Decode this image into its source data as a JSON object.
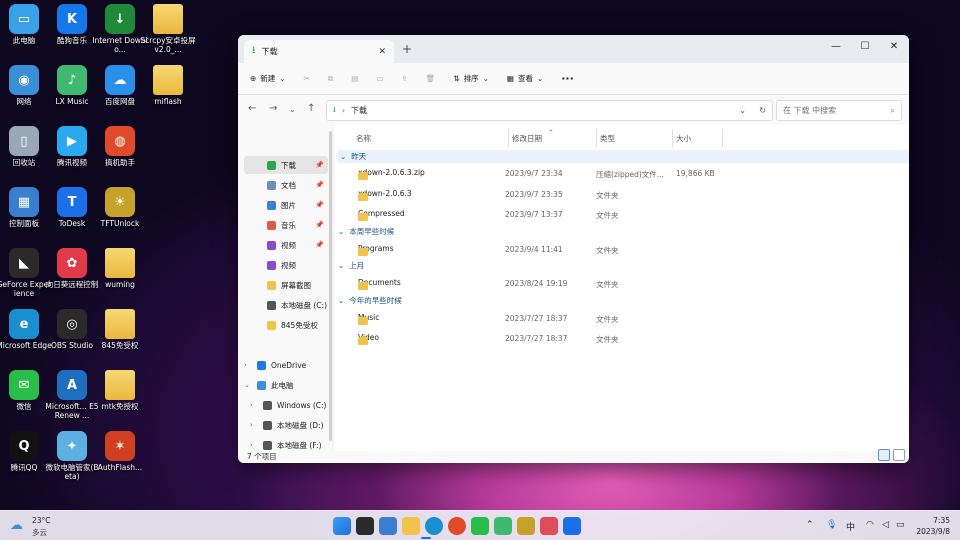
{
  "desktop": [
    {
      "label": "此电脑",
      "color": "#3aa0e8",
      "glyph": "▭"
    },
    {
      "label": "网络",
      "color": "#3a8fd8",
      "glyph": "◉"
    },
    {
      "label": "回收站",
      "color": "#9aa7b8",
      "glyph": "▯"
    },
    {
      "label": "控制面板",
      "color": "#3a7fcf",
      "glyph": "▦"
    },
    {
      "label": "GeForce Experience",
      "color": "#2a2a2a",
      "glyph": "◣"
    },
    {
      "label": "Microsoft Edge",
      "color": "#1a8fd0",
      "glyph": "e"
    },
    {
      "label": "微信",
      "color": "#2bbd4a",
      "glyph": "✉"
    },
    {
      "label": "腾讯QQ",
      "color": "#111111",
      "glyph": "Q"
    },
    {
      "label": "酷狗音乐",
      "color": "#1577e8",
      "glyph": "K"
    },
    {
      "label": "LX Music",
      "color": "#3fb96f",
      "glyph": "♪"
    },
    {
      "label": "腾讯视频",
      "color": "#2aa8f0",
      "glyph": "▶"
    },
    {
      "label": "ToDesk",
      "color": "#1b6fe8",
      "glyph": "T"
    },
    {
      "label": "向日葵远程控制",
      "color": "#e23a4a",
      "glyph": "✿"
    },
    {
      "label": "OBS Studio",
      "color": "#2a2a2a",
      "glyph": "◎"
    },
    {
      "label": "Microsoft... E5 Renew ...",
      "color": "#1f6fc0",
      "glyph": "A"
    },
    {
      "label": "微软电脑管家(Beta)",
      "color": "#5ab0e0",
      "glyph": "✦"
    },
    {
      "label": "Internet Downlo...",
      "color": "#1e8a3a",
      "glyph": "↓"
    },
    {
      "label": "百度网盘",
      "color": "#2a8fe8",
      "glyph": "☁"
    },
    {
      "label": "搞机助手",
      "color": "#e04a2a",
      "glyph": "◍"
    },
    {
      "label": "TFTUnlock",
      "color": "#c7a22a",
      "glyph": "☀"
    },
    {
      "label": "wuming",
      "color": "folder",
      "glyph": ""
    },
    {
      "label": "845免受权",
      "color": "folder",
      "glyph": ""
    },
    {
      "label": "mtk免授权",
      "color": "folder",
      "glyph": ""
    },
    {
      "label": "AuthFlash...",
      "color": "#d04020",
      "glyph": "✶"
    },
    {
      "label": "Scrcpy安卓投屏v2.0_...",
      "color": "folder",
      "glyph": ""
    },
    {
      "label": "miflash",
      "color": "folder",
      "glyph": ""
    }
  ],
  "window": {
    "tab_title": "下载",
    "new_tab": "+",
    "toolbar": {
      "new_label": "新建",
      "sort_label": "排序",
      "view_label": "查看",
      "more": "···"
    },
    "path": "下载",
    "search_placeholder": "在 下载 中搜索",
    "sidebar": [
      {
        "label": "下载",
        "pin": true,
        "sel": true,
        "color": "#2aa84a"
      },
      {
        "label": "文档",
        "pin": true,
        "color": "#6b8fc0"
      },
      {
        "label": "图片",
        "pin": true,
        "color": "#3a7fd8"
      },
      {
        "label": "音乐",
        "pin": true,
        "color": "#e05a4a"
      },
      {
        "label": "视频",
        "pin": true,
        "color": "#8a4ad0"
      },
      {
        "label": "视频",
        "pin": false,
        "color": "#8a4ad0"
      },
      {
        "label": "屏幕截图",
        "pin": false,
        "color": "#f1c34a"
      },
      {
        "label": "本地磁盘 (C:)",
        "pin": false,
        "color": "#555555"
      },
      {
        "label": "845免受权",
        "pin": false,
        "color": "#f1c34a"
      },
      {
        "label": "OneDrive",
        "pin": false,
        "color": "#1f7ae0",
        "chev": "›"
      },
      {
        "label": "此电脑",
        "pin": false,
        "color": "#3a8fd8",
        "chev": "⌄"
      },
      {
        "label": "Windows (C:)",
        "pin": false,
        "color": "#555555",
        "chev": "›",
        "indent": true
      },
      {
        "label": "本地磁盘 (D:)",
        "pin": false,
        "color": "#555555",
        "chev": "›",
        "indent": true
      },
      {
        "label": "本地磁盘 (F:)",
        "pin": false,
        "color": "#555555",
        "chev": "›",
        "indent": true
      },
      {
        "label": "网络",
        "pin": false,
        "color": "#3a8fd8",
        "chev": "›"
      }
    ],
    "columns": {
      "name": "名称",
      "date": "修改日期",
      "type": "类型",
      "size": "大小"
    },
    "groups": [
      {
        "label": "昨天",
        "rows": [
          {
            "name": "xdown-2.0.6.3.zip",
            "date": "2023/9/7 23:34",
            "type": "压缩(zipped)文件...",
            "size": "19,866 KB"
          },
          {
            "name": "xdown-2.0.6.3",
            "date": "2023/9/7 23:35",
            "type": "文件夹",
            "size": ""
          },
          {
            "name": "Compressed",
            "date": "2023/9/7 13:37",
            "type": "文件夹",
            "size": ""
          }
        ]
      },
      {
        "label": "本周早些时候",
        "rows": [
          {
            "name": "Programs",
            "date": "2023/9/4 11:41",
            "type": "文件夹",
            "size": ""
          }
        ]
      },
      {
        "label": "上月",
        "rows": [
          {
            "name": "Documents",
            "date": "2023/8/24 19:19",
            "type": "文件夹",
            "size": ""
          }
        ]
      },
      {
        "label": "今年的早些时候",
        "rows": [
          {
            "name": "Music",
            "date": "2023/7/27 18:37",
            "type": "文件夹",
            "size": ""
          },
          {
            "name": "Video",
            "date": "2023/7/27 18:37",
            "type": "文件夹",
            "size": ""
          }
        ]
      }
    ],
    "status": "7 个项目"
  },
  "taskbar": {
    "weather_temp": "23°C",
    "weather_desc": "多云",
    "apps": [
      "#1f6fe0",
      "#2a2a2a",
      "#3a7fcf",
      "#f1c34a",
      "#1a8fd0",
      "#e04a2a",
      "#2bbd4a",
      "#3fb96f",
      "#c7a22a",
      "#e04a5a",
      "#1b6fe8"
    ],
    "ime": "中",
    "time": "7:35",
    "date": "2023/9/8"
  }
}
